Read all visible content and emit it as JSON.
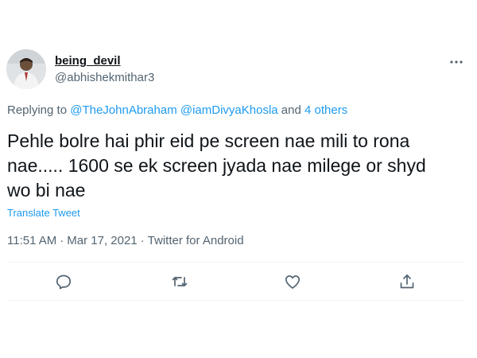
{
  "tweet": {
    "display_name": "being_devil",
    "username": "@abhishekmithar3",
    "reply": {
      "prefix": "Replying to ",
      "mention_1": "@TheJohnAbraham",
      "mention_2": "@iamDivyaKhosla",
      "middle": " and ",
      "others": "4 others"
    },
    "text": "Pehle bolre hai phir eid pe screen nae mili to rona nae..... 1600 se ek screen jyada nae milege or shyd wo bi nae",
    "translate_label": "Translate Tweet",
    "time": "11:51 AM",
    "separator": "·",
    "date": "Mar 17, 2021",
    "source": "Twitter for Android"
  },
  "colors": {
    "link": "#1d9bf0",
    "secondary_text": "#536471",
    "primary_text": "#0f1419",
    "divider": "#eff3f4"
  },
  "icons": {
    "more": "more-horizontal-icon",
    "reply": "reply-icon",
    "retweet": "retweet-icon",
    "like": "heart-icon",
    "share": "share-icon"
  }
}
